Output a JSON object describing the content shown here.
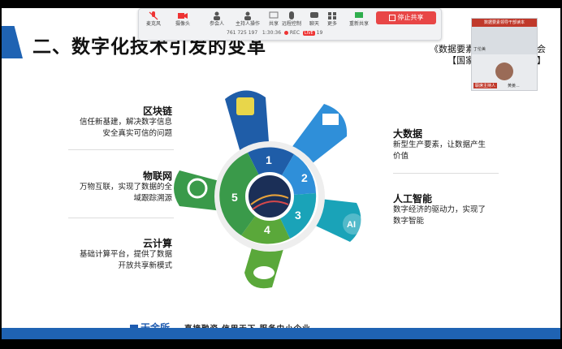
{
  "slide": {
    "title": "二、数字化技术引发的变革",
    "reference_lines": [
      "《数据要素领导干部读本》会",
      "【国家行政管理出版社】"
    ],
    "hub_numbers": [
      "1",
      "2",
      "3",
      "4",
      "5"
    ],
    "left_items": [
      {
        "title": "区块链",
        "desc_lines": [
          "信任新基建，解决数字信息",
          "安全真实可信的问题"
        ]
      },
      {
        "title": "物联网",
        "desc_lines": [
          "万物互联，实现了数据的全",
          "域跟踪溯源"
        ]
      },
      {
        "title": "云计算",
        "desc_lines": [
          "基础计算平台，提供了数据",
          "开放共享新模式"
        ]
      }
    ],
    "right_items": [
      {
        "title": "大数据",
        "desc_lines": [
          "新型生产要素，让数据产生",
          "价值"
        ]
      },
      {
        "title": "人工智能",
        "desc_lines": [
          "数字经济的驱动力，实现了",
          "数字智能"
        ]
      }
    ],
    "footer": {
      "logo": "天金所",
      "slogan": "直接融资 信用天下 服务中小企业"
    },
    "ai_icon_text": "AI"
  },
  "toolbar": {
    "buttons": [
      "麦克风",
      "摄像头",
      "参会人",
      "主持人操作",
      "共享",
      "远程控制",
      "聊天",
      "更多",
      "重新共享"
    ],
    "participant_count": "25",
    "meeting_id": "761 725 197",
    "timer": "1:30:36",
    "rec_label": "REC",
    "live_label": "LIVE",
    "live_count": "19",
    "stop_share_label": "停止共享"
  },
  "video": {
    "caption": "数据要素领导干部读本",
    "speaker_name": "丁伦美",
    "host_badge": "联席主持人",
    "participant_name": "黄姜..."
  },
  "colors": {
    "petal_1": "#1f5da8",
    "petal_2": "#2f8fd9",
    "petal_3": "#1aa3b8",
    "petal_4": "#5aa83a",
    "petal_5": "#3a9a4a",
    "accent": "#1f63b3",
    "share_red": "#e84646"
  }
}
